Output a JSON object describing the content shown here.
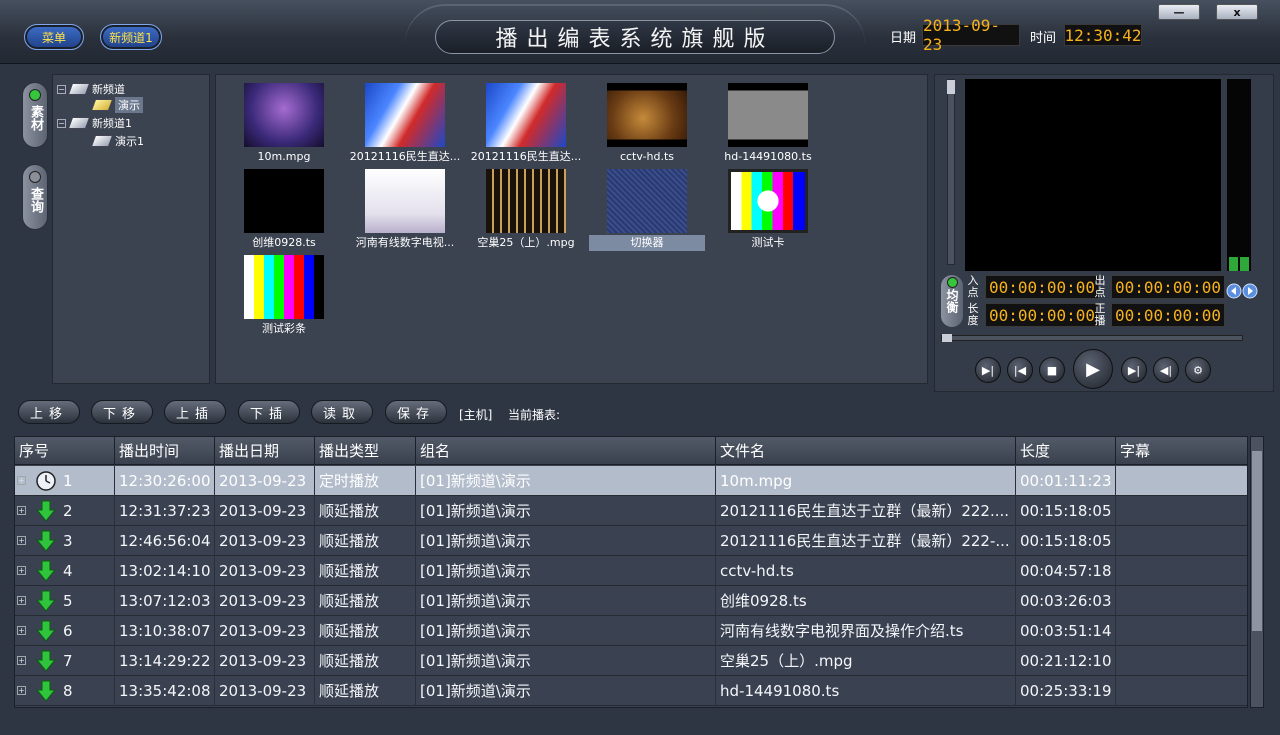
{
  "header": {
    "menu_label": "菜单",
    "channel_label": "新频道1",
    "title": "播出编表系统旗舰版",
    "date_label": "日期",
    "date_value": "2013-09-23",
    "time_label": "时间",
    "time_value": "12:30:42",
    "min_label": "—",
    "close_label": "x"
  },
  "side_tabs": {
    "material": "素材",
    "query": "查询"
  },
  "tree": {
    "nodes": [
      {
        "label": "新频道"
      },
      {
        "label": "演示"
      },
      {
        "label": "新频道1"
      },
      {
        "label": "演示1"
      }
    ]
  },
  "media": [
    {
      "label": "10m.mpg"
    },
    {
      "label": "20121116民生直达..."
    },
    {
      "label": "20121116民生直达..."
    },
    {
      "label": "cctv-hd.ts"
    },
    {
      "label": "hd-14491080.ts"
    },
    {
      "label": "创维0928.ts"
    },
    {
      "label": "河南有线数字电视..."
    },
    {
      "label": "空巢25（上）.mpg"
    },
    {
      "label": "切换器"
    },
    {
      "label": "测试卡"
    },
    {
      "label": "测试彩条"
    }
  ],
  "preview": {
    "balance": "均衡",
    "in_label": "入点",
    "out_label": "出点",
    "length_label": "长度",
    "playing_label": "正播",
    "in_tc": "00:00:00:00",
    "out_tc": "00:00:00:00",
    "length_tc": "00:00:00:00",
    "playing_tc": "00:00:00:00"
  },
  "toolbar": {
    "move_up": "上移",
    "move_down": "下移",
    "insert_above": "上插",
    "insert_below": "下插",
    "read": "读取",
    "save": "保存",
    "host": "[主机]",
    "current_list": "当前播表:"
  },
  "table": {
    "columns": [
      "序号",
      "播出时间",
      "播出日期",
      "播出类型",
      "组名",
      "文件名",
      "长度",
      "字幕"
    ],
    "rows": [
      {
        "num": "1",
        "time": "12:30:26:00",
        "date": "2013-09-23",
        "type": "定时播放",
        "group": "[01]新频道\\演示",
        "file": "10m.mpg",
        "length": "00:01:11:23",
        "subtitle": ""
      },
      {
        "num": "2",
        "time": "12:31:37:23",
        "date": "2013-09-23",
        "type": "顺延播放",
        "group": "[01]新频道\\演示",
        "file": "20121116民生直达于立群（最新）222....",
        "length": "00:15:18:05",
        "subtitle": ""
      },
      {
        "num": "3",
        "time": "12:46:56:04",
        "date": "2013-09-23",
        "type": "顺延播放",
        "group": "[01]新频道\\演示",
        "file": "20121116民生直达于立群（最新）222-...",
        "length": "00:15:18:05",
        "subtitle": ""
      },
      {
        "num": "4",
        "time": "13:02:14:10",
        "date": "2013-09-23",
        "type": "顺延播放",
        "group": "[01]新频道\\演示",
        "file": "cctv-hd.ts",
        "length": "00:04:57:18",
        "subtitle": ""
      },
      {
        "num": "5",
        "time": "13:07:12:03",
        "date": "2013-09-23",
        "type": "顺延播放",
        "group": "[01]新频道\\演示",
        "file": "创维0928.ts",
        "length": "00:03:26:03",
        "subtitle": ""
      },
      {
        "num": "6",
        "time": "13:10:38:07",
        "date": "2013-09-23",
        "type": "顺延播放",
        "group": "[01]新频道\\演示",
        "file": "河南有线数字电视界面及操作介绍.ts",
        "length": "00:03:51:14",
        "subtitle": ""
      },
      {
        "num": "7",
        "time": "13:14:29:22",
        "date": "2013-09-23",
        "type": "顺延播放",
        "group": "[01]新频道\\演示",
        "file": "空巢25（上）.mpg",
        "length": "00:21:12:10",
        "subtitle": ""
      },
      {
        "num": "8",
        "time": "13:35:42:08",
        "date": "2013-09-23",
        "type": "顺延播放",
        "group": "[01]新频道\\演示",
        "file": "hd-14491080.ts",
        "length": "00:25:33:19",
        "subtitle": ""
      }
    ]
  },
  "colors": {
    "accent": "#f7b21b",
    "lcd_bg": "#111111",
    "ok": "#35c63b"
  }
}
